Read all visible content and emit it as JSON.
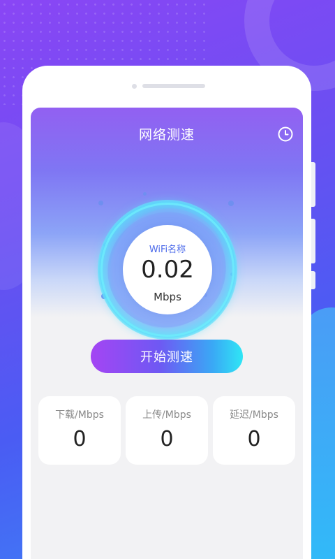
{
  "app": {
    "title": "网络测速"
  },
  "icons": {
    "history": "history-clock-icon"
  },
  "gauge": {
    "wifi_name": "WiFi名称",
    "speed": "0.02",
    "unit": "Mbps"
  },
  "start_button": {
    "label": "开始测速"
  },
  "stats": [
    {
      "label": "下载/Mbps",
      "value": "0"
    },
    {
      "label": "上传/Mbps",
      "value": "0"
    },
    {
      "label": "延迟/Mbps",
      "value": "0"
    }
  ],
  "colors": {
    "accent_purple": "#a445f3",
    "accent_cyan": "#2fe6f5",
    "wifi_name": "#4d6bea"
  }
}
